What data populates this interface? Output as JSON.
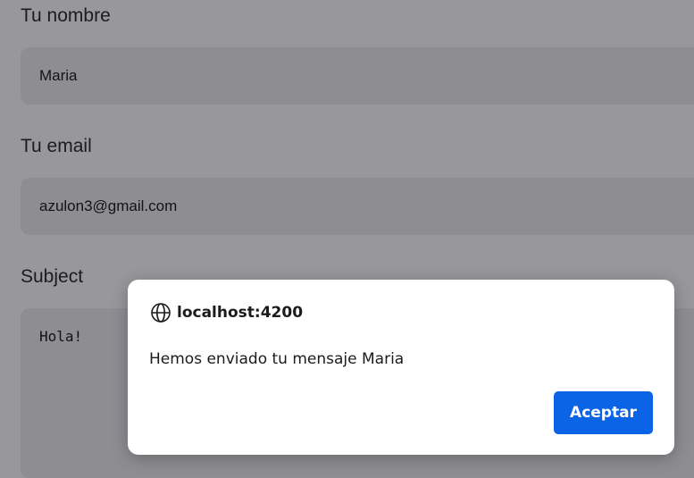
{
  "form": {
    "name_label": "Tu nombre",
    "name_value": "Maria",
    "email_label": "Tu email",
    "email_value": "azulon3@gmail.com",
    "subject_label": "Subject",
    "message_value": "Hola!"
  },
  "dialog": {
    "origin": "localhost:4200",
    "origin_icon": "globe-icon",
    "message": "Hemos enviado tu mensaje Maria",
    "accept_label": "Aceptar"
  },
  "colors": {
    "overlay_background": "#97979c",
    "field_background": "#8d8d92",
    "dialog_background": "#ffffff",
    "accent": "#0b63e5"
  }
}
